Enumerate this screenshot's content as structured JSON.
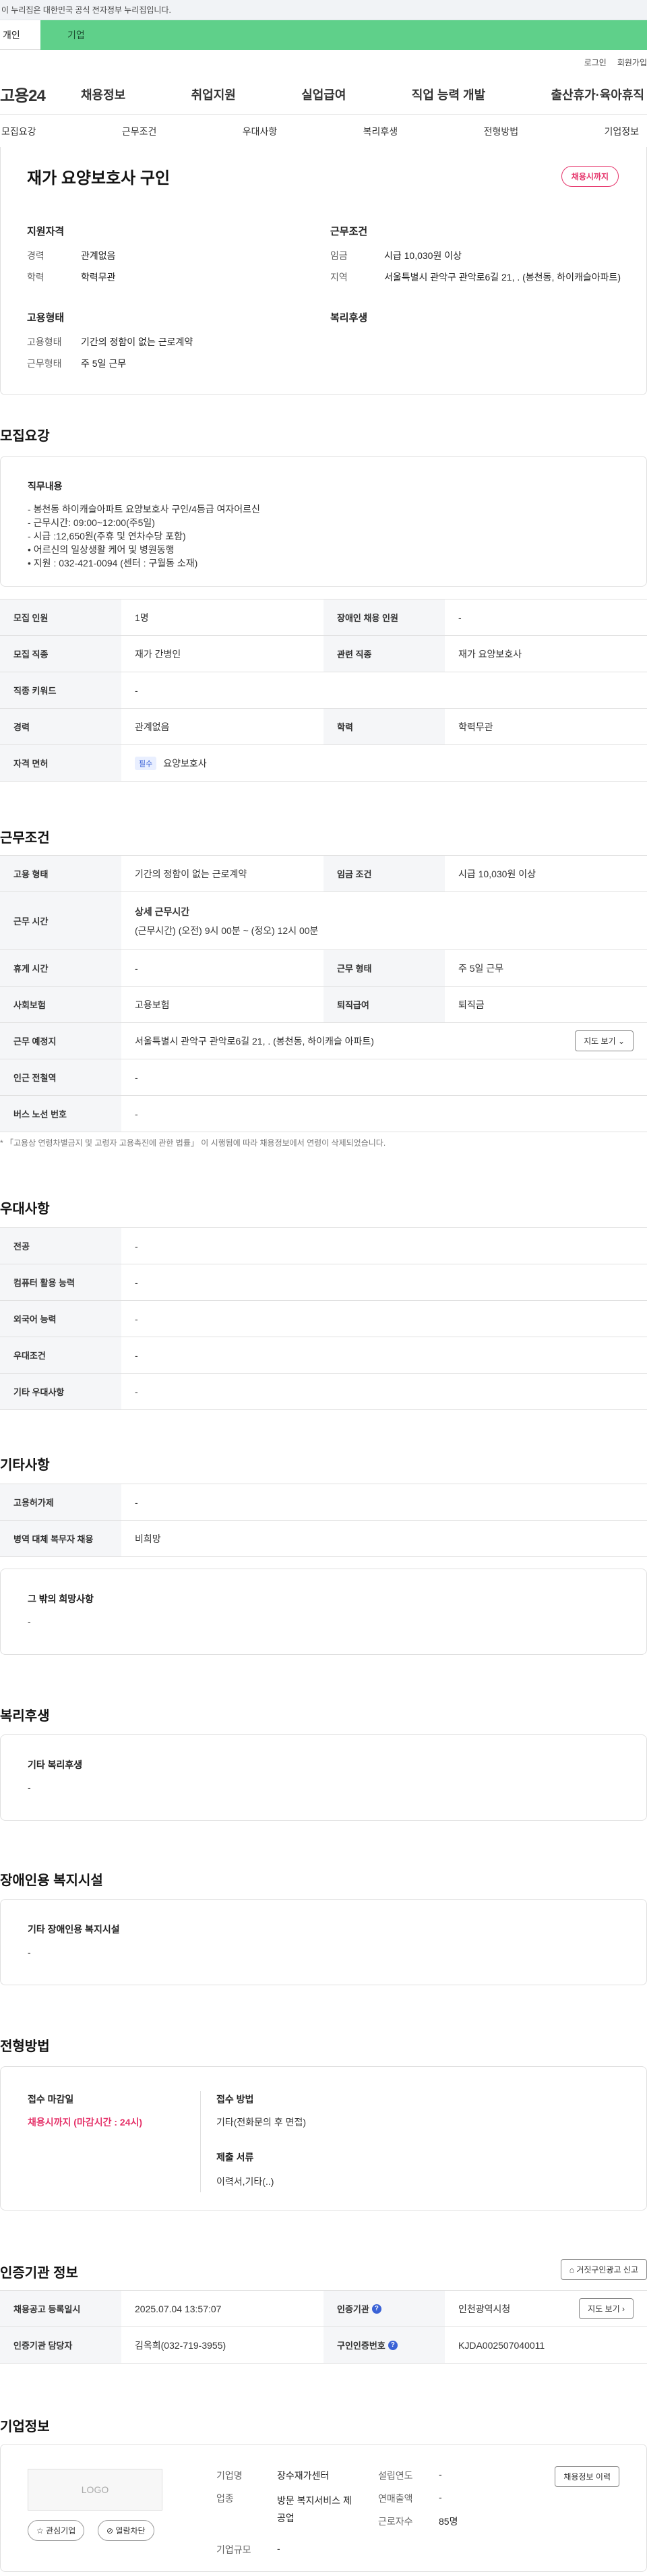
{
  "top": {
    "gov_notice": "이 누리집은 대한민국 공식 전자정부 누리집입니다.",
    "tab_personal": "개인",
    "tab_corporate": "기업",
    "login": "로그인",
    "signup": "회원가입",
    "logo": "고용24",
    "gnb": [
      "채용정보",
      "취업지원",
      "실업급여",
      "직업 능력 개발",
      "출산휴가·육아휴직"
    ],
    "anchors": [
      "모집요강",
      "근무조건",
      "우대사항",
      "복리후생",
      "전형방법",
      "기업정보"
    ]
  },
  "hero": {
    "title": "재가 요양보호사 구인",
    "badge": "채용시까지",
    "qual_title": "지원자격",
    "qual": [
      {
        "k": "경력",
        "v": "관계없음"
      },
      {
        "k": "학력",
        "v": "학력무관"
      }
    ],
    "cond_title": "근무조건",
    "cond": [
      {
        "k": "임금",
        "v": "시급 10,030원 이상"
      },
      {
        "k": "지역",
        "v": "서울특별시 관악구 관악로6길 21, . (봉천동, 하이캐슬아파트)"
      }
    ],
    "emp_title": "고용형태",
    "emp": [
      {
        "k": "고용형태",
        "v": "기간의 정함이 없는 근로계약"
      },
      {
        "k": "근무형태",
        "v": "주 5일 근무"
      }
    ],
    "welfare_title": "복리후생"
  },
  "recruit": {
    "title": "모집요강",
    "duty_label": "직무내용",
    "duty_text": "-  봉천동 하이캐슬아파트 요양보호사 구인/4등급 여자어르신\n- 근무시간: 09:00~12:00(주5일)\n- 시급 :12,650원(주휴 및  연차수당 포함)\n• 어르신의 일상생활 케어 및 병원동행\n• 지원 : 032-421-0094 (센터 : 구월동 소재)",
    "rows": {
      "count_label": "모집 인원",
      "count": "1명",
      "disabled_label": "장애인 채용 인원",
      "disabled": "-",
      "job_label": "모집 직종",
      "job": "재가 간병인",
      "related_label": "관련 직종",
      "related": "재가 요양보호사",
      "keyword_label": "직종 키워드",
      "keyword": "-",
      "career_label": "경력",
      "career": "관계없음",
      "edu_label": "학력",
      "edu": "학력무관",
      "license_label": "자격 면허",
      "license_chip": "필수",
      "license": "요양보호사"
    }
  },
  "work": {
    "title": "근무조건",
    "type_label": "고용 형태",
    "type": "기간의 정함이 없는 근로계약",
    "wage_label": "임금 조건",
    "wage": "시급 10,030원 이상",
    "hours_label": "근무 시간",
    "hours_head": "상세 근무시간",
    "hours": "(근무시간) (오전) 9시 00분 ~ (정오) 12시 00분",
    "break_label": "휴게 시간",
    "break": "-",
    "form_label": "근무 형태",
    "form": "주 5일 근무",
    "ins_label": "사회보험",
    "ins": "고용보험",
    "sev_label": "퇴직급여",
    "sev": "퇴직금",
    "place_label": "근무 예정지",
    "place": "서울특별시 관악구 관악로6길 21, . (봉천동, 하이캐슬 아파트)",
    "map_btn": "지도 보기",
    "subway_label": "인근 전철역",
    "subway": "-",
    "bus_label": "버스 노선 번호",
    "bus": "-",
    "note": "* 「고용상 연령차별금지 및 고령자 고용촉진에 관한 법률」 이 시행됨에 따라 채용정보에서 연령이 삭제되었습니다."
  },
  "pref": {
    "title": "우대사항",
    "major_label": "전공",
    "major": "-",
    "pc_label": "컴퓨터 활용 능력",
    "pc": "-",
    "lang_label": "외국어 능력",
    "lang": "-",
    "cond_label": "우대조건",
    "cond": "-",
    "etc_label": "기타 우대사항",
    "etc": "-"
  },
  "other": {
    "title": "기타사항",
    "equip_label": "고용허가제",
    "equip": "-",
    "mil_label": "병역 대체 복무자 채용",
    "mil": "비희망",
    "wish_label": "그 밖의 희망사항",
    "wish": "-"
  },
  "welfare": {
    "title": "복리후생",
    "label": "기타 복리후생",
    "value": "-"
  },
  "facility": {
    "title": "장애인용 복지시설",
    "label": "기타 장애인용 복지시설",
    "value": "-"
  },
  "process": {
    "title": "전형방법",
    "deadline_label": "접수 마감일",
    "deadline": "채용시까지 (마감시간 : 24시)",
    "method_label": "접수 방법",
    "method": "기타(전화문의 후 면접)",
    "docs_label": "제출 서류",
    "docs": "이력서,기타(..)"
  },
  "agency": {
    "title": "인증기관 정보",
    "report_btn": "거짓구인광고 신고",
    "reg_label": "채용공고 등록일시",
    "reg": "2025.07.04 13:57:07",
    "org_label": "인증기관",
    "org": "인천광역시청",
    "map_btn": "지도 보기",
    "mgr_label": "인증기관 담당자",
    "mgr": "김옥희(032-719-3955)",
    "no_label": "구인인증번호",
    "no": "KJDA002507040011"
  },
  "company": {
    "title": "기업정보",
    "logo": "LOGO",
    "fav_btn": "관심기업",
    "block_btn": "열람차단",
    "name_label": "기업명",
    "name": "장수재가센터",
    "industry_label": "업종",
    "industry": "방문 복지서비스 제공업",
    "size_label": "기업규모",
    "size": "-",
    "founded_label": "설립연도",
    "founded": "-",
    "sales_label": "연매출액",
    "sales": "-",
    "emp_label": "근로자수",
    "emp": "85명",
    "history_btn": "채용정보 이력"
  }
}
